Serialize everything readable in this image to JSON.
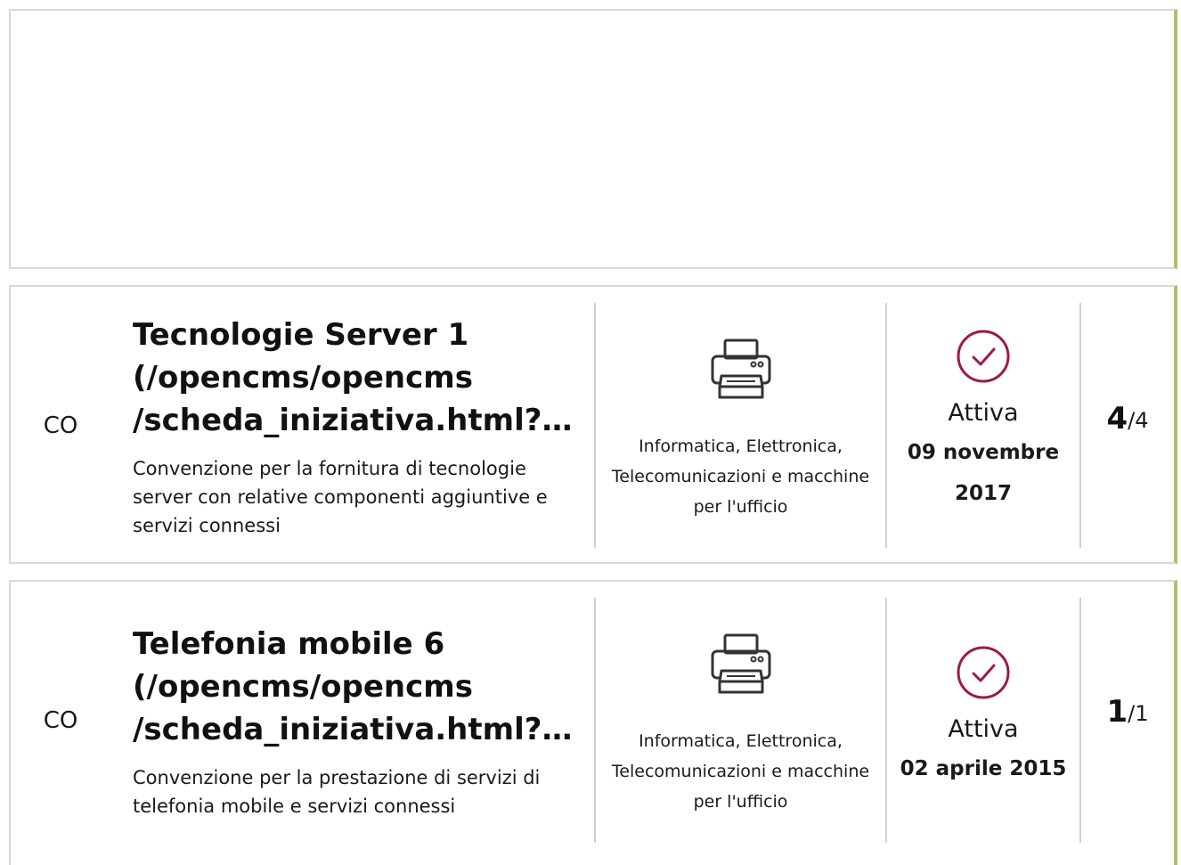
{
  "colors": {
    "accent_border": "#b5bd6f",
    "card_border": "#d9d9d9",
    "check_color": "#9b1b4a",
    "divider": "#d0d0d0"
  },
  "items": [
    {
      "code": "CO",
      "title_lines": [
        "Tecnologie Server 1",
        "(/opencms/opencms",
        "/scheda_iniziativa.html?id..."
      ],
      "description": "Convenzione per la fornitura di tecnologie server con relative componenti aggiuntive e servizi connessi",
      "category_icon": "printer-icon",
      "category": "Informatica, Elettronica, Telecomunicazioni e macchine per l'ufficio",
      "status_icon": "check-circle-icon",
      "status": "Attiva",
      "date": "09 novembre 2017",
      "lots_active": "4",
      "lots_total": "/4"
    },
    {
      "code": "CO",
      "title_lines": [
        "Telefonia mobile 6",
        "(/opencms/opencms",
        "/scheda_iniziativa.html?id..."
      ],
      "description": "Convenzione per la prestazione di servizi di telefonia mobile e servizi connessi",
      "category_icon": "printer-icon",
      "category": "Informatica, Elettronica, Telecomunicazioni e macchine per l'ufficio",
      "status_icon": "check-circle-icon",
      "status": "Attiva",
      "date": "02 aprile 2015",
      "lots_active": "1",
      "lots_total": "/1"
    }
  ]
}
